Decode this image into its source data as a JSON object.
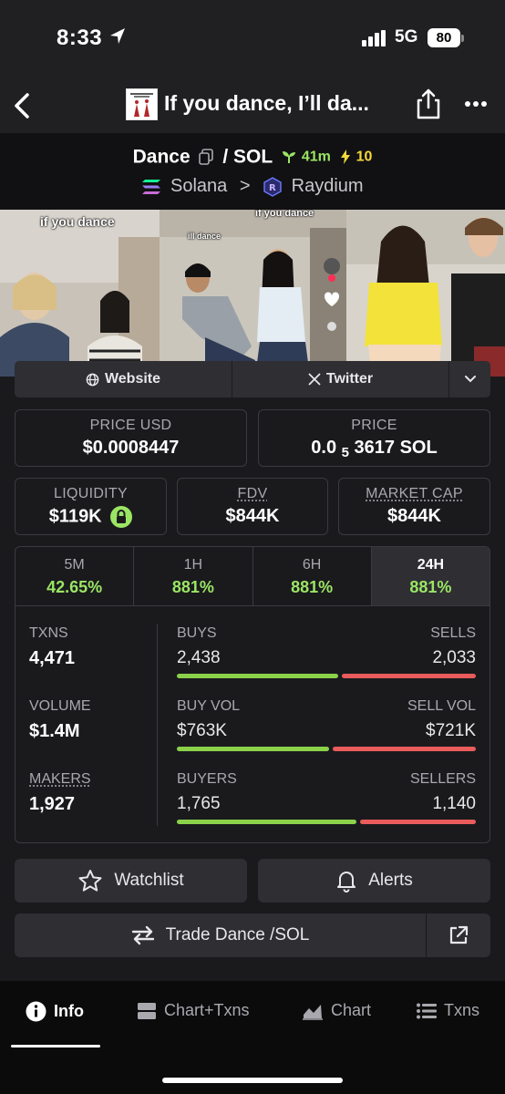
{
  "status_bar": {
    "time": "8:33",
    "network": "5G",
    "battery": "80"
  },
  "nav": {
    "title": "If you dance, I’ll da...",
    "thumb_caption": "IF YOU DANCE... I'LL DANCE"
  },
  "pair": {
    "base": "Dance",
    "quote": "/ SOL",
    "age": "41m",
    "boosts": "10",
    "chain": "Solana",
    "separator": ">",
    "dex": "Raydium"
  },
  "banner": {
    "caption_left": "if you dance",
    "caption_mid_top": "if you dance",
    "caption_mid": "ill dance"
  },
  "links": {
    "website": "Website",
    "twitter": "Twitter"
  },
  "prices": {
    "usd_label": "PRICE USD",
    "usd_value": "$0.0008447",
    "native_label": "PRICE",
    "native_prefix": "0.0",
    "native_sub": "5",
    "native_rest": "3617 SOL"
  },
  "metrics": {
    "liquidity_label": "LIQUIDITY",
    "liquidity_value": "$119K",
    "fdv_label": "FDV",
    "fdv_value": "$844K",
    "mcap_label": "MARKET CAP",
    "mcap_value": "$844K"
  },
  "timeframes": [
    {
      "label": "5M",
      "value": "42.65%"
    },
    {
      "label": "1H",
      "value": "881%"
    },
    {
      "label": "6H",
      "value": "881%"
    },
    {
      "label": "24H",
      "value": "881%",
      "active": true
    }
  ],
  "stats": {
    "txns_label": "TXNS",
    "txns_value": "4,471",
    "volume_label": "VOLUME",
    "volume_value": "$1.4M",
    "makers_label": "MAKERS",
    "makers_value": "1,927",
    "buys_label": "BUYS",
    "buys_value": "2,438",
    "sells_label": "SELLS",
    "sells_value": "2,033",
    "buyvol_label": "BUY VOL",
    "buyvol_value": "$763K",
    "sellvol_label": "SELL VOL",
    "sellvol_value": "$721K",
    "buyers_label": "BUYERS",
    "buyers_value": "1,765",
    "sellers_label": "SELLERS",
    "sellers_value": "1,140",
    "buys_fraction": 0.545,
    "buyvol_fraction": 0.514,
    "buyers_fraction": 0.608
  },
  "actions": {
    "watchlist": "Watchlist",
    "alerts": "Alerts",
    "trade": "Trade Dance /SOL"
  },
  "tabbar": {
    "info": "Info",
    "chart_txns": "Chart+Txns",
    "chart": "Chart",
    "txns": "Txns"
  },
  "colors": {
    "green": "#9be564",
    "red": "#ea5b5b",
    "boost": "#f5d93b"
  }
}
